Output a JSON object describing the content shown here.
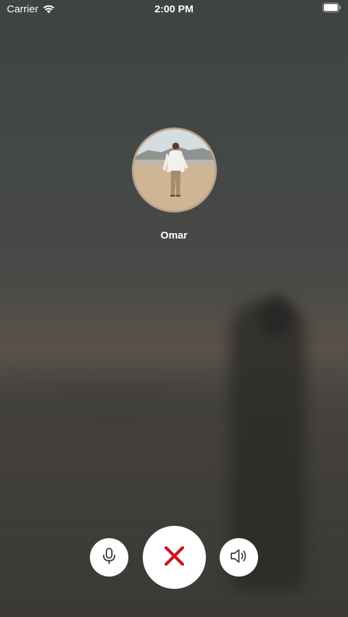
{
  "status_bar": {
    "carrier": "Carrier",
    "time": "2:00 PM"
  },
  "caller": {
    "name": "Omar"
  },
  "controls": {
    "mute_icon": "microphone-icon",
    "end_call_icon": "close-icon",
    "speaker_icon": "speaker-icon",
    "end_call_color": "#d0151f"
  }
}
